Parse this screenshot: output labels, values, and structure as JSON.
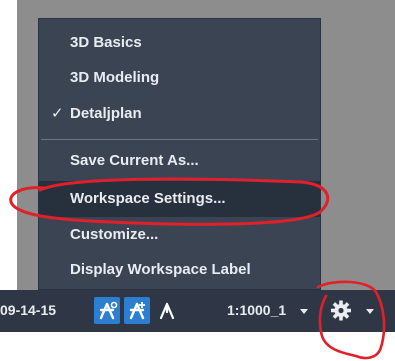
{
  "menu": {
    "items": [
      {
        "label": "3D Basics",
        "checked": false
      },
      {
        "label": "3D Modeling",
        "checked": false
      },
      {
        "label": "Detaljplan",
        "checked": true
      },
      {
        "label": "Save Current As...",
        "checked": false
      },
      {
        "label": "Workspace Settings...",
        "checked": false
      },
      {
        "label": "Customize...",
        "checked": false
      },
      {
        "label": "Display Workspace Label",
        "checked": false
      }
    ],
    "check_mark": "✓"
  },
  "statusbar": {
    "date_fragment": "09-14-15",
    "annotation_scale": "1:1000_1",
    "icons": [
      "annotation-visibility-icon",
      "auto-scale-icon",
      "annotation-scale-icon",
      "workspace-gear-icon"
    ]
  },
  "colors": {
    "menu_bg": "#3b4453",
    "menu_hover": "#27303d",
    "statusbar_bg": "#2f3746",
    "active_button": "#2c7fd0",
    "annotation_red": "#e0202a"
  }
}
